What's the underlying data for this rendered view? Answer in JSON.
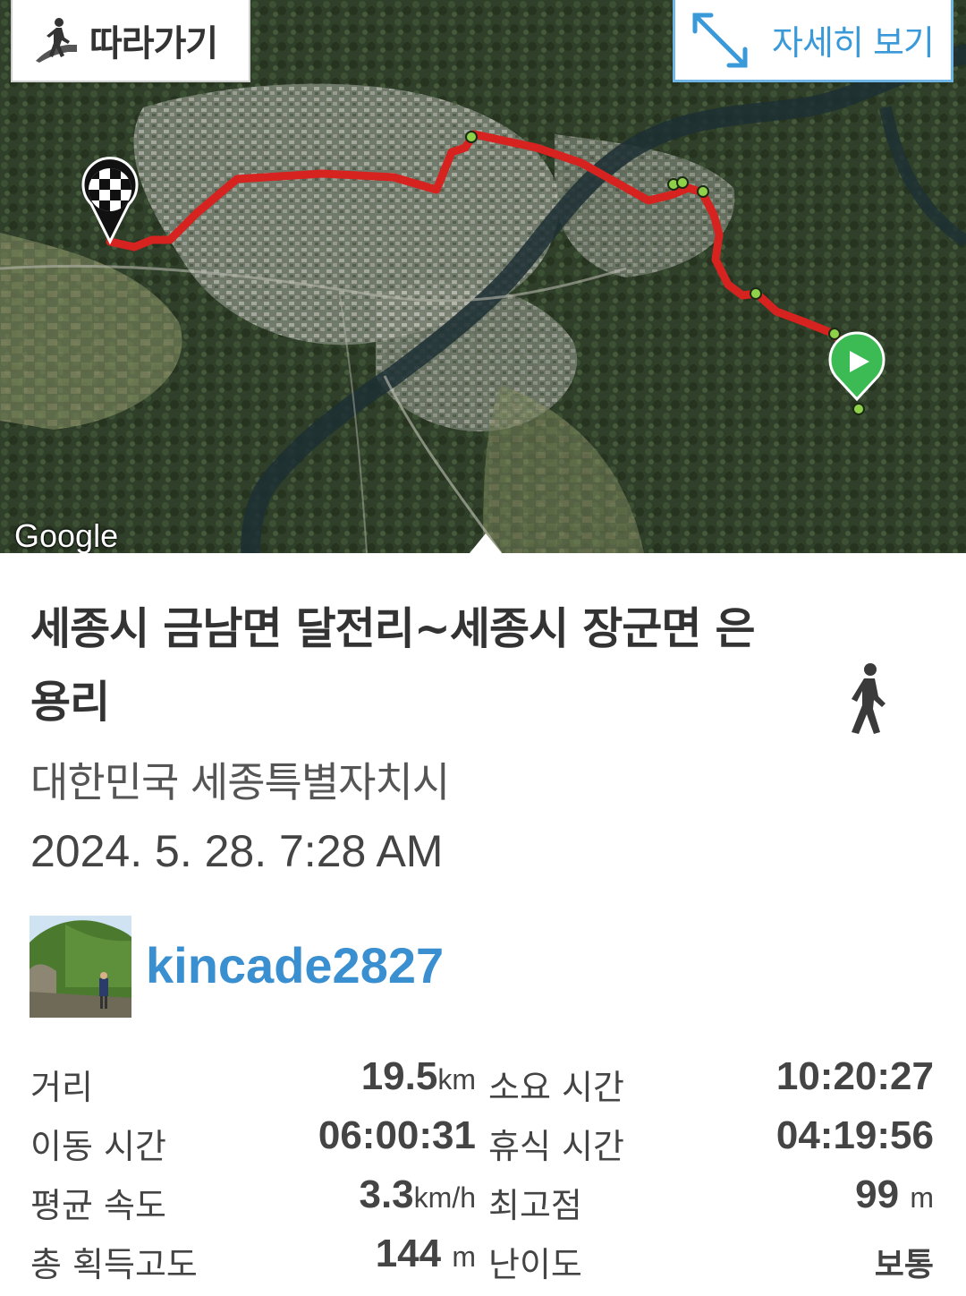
{
  "map": {
    "follow_label": "따라가기",
    "detail_label": "자세히 보기",
    "attribution": "Google",
    "route_color": "#d6231f",
    "waypoint_color": "#8fd24a",
    "start_marker_color": "#3cba54"
  },
  "track": {
    "title": "세종시 금남면 달전리~세종시 장군면 은용리",
    "region": "대한민국 세종특별자치시",
    "datetime": "2024. 5. 28. 7:28 AM",
    "activity_icon": "walking-icon"
  },
  "user": {
    "name": "kincade2827",
    "accent": "#3a8fd0"
  },
  "stats": {
    "distance": {
      "label": "거리",
      "value": "19.5",
      "unit": "km"
    },
    "duration": {
      "label": "소요 시간",
      "value": "10:20:27"
    },
    "moving_time": {
      "label": "이동 시간",
      "value": "06:00:31"
    },
    "rest_time": {
      "label": "휴식 시간",
      "value": "04:19:56"
    },
    "avg_speed": {
      "label": "평균 속도",
      "value": "3.3",
      "unit": "km/h"
    },
    "max_elevation": {
      "label": "최고점",
      "value": "99",
      "unit": "m"
    },
    "total_ascent": {
      "label": "총 획득고도",
      "value": "144",
      "unit": "m"
    },
    "difficulty": {
      "label": "난이도",
      "value": "보통"
    }
  }
}
